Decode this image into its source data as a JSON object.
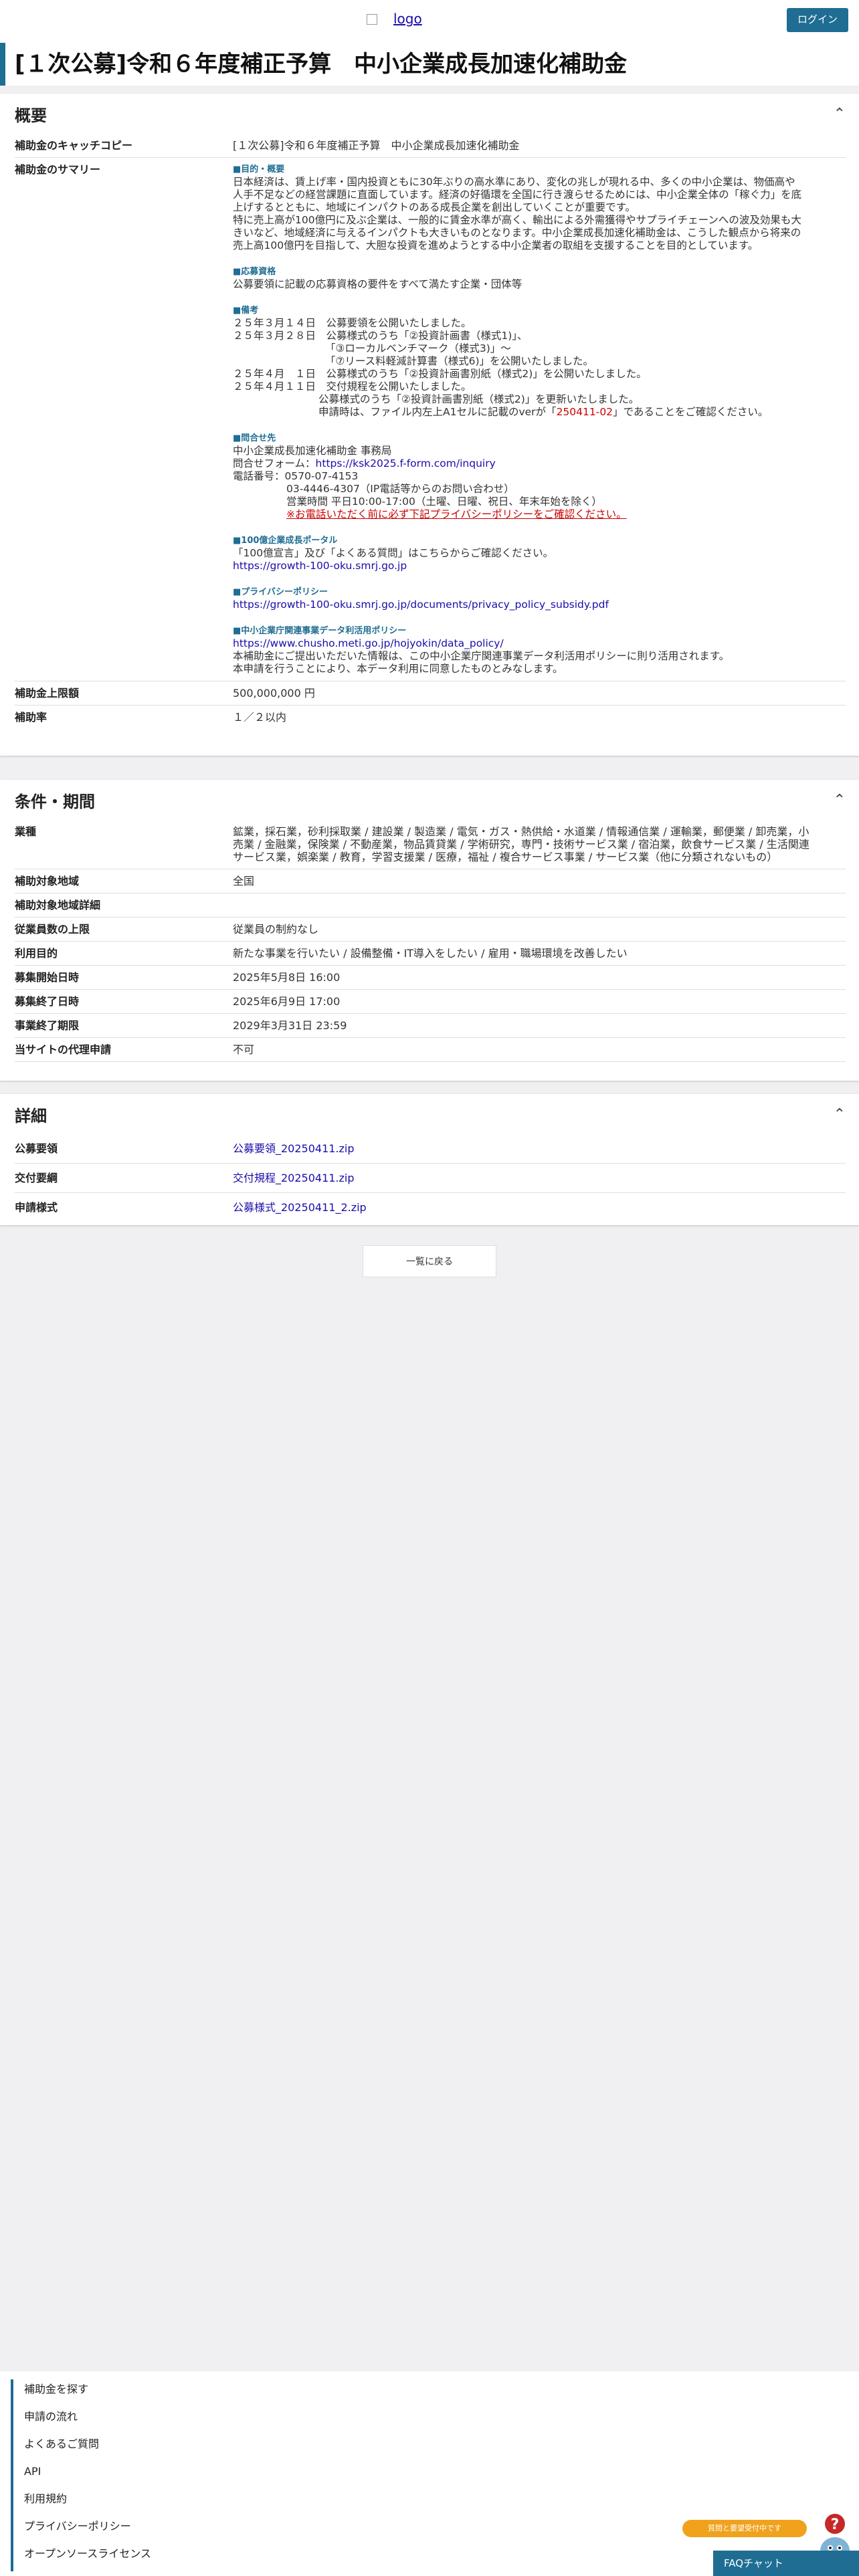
{
  "header": {
    "logo_alt": "logo",
    "login_label": "ログイン"
  },
  "page_title": "[１次公募]令和６年度補正予算　中小企業成長加速化補助金",
  "overview": {
    "heading": "概要",
    "catch_label": "補助金のキャッチコピー",
    "catch_value": "[１次公募]令和６年度補正予算　中小企業成長加速化補助金",
    "summary_label": "補助金のサマリー",
    "purpose_head": "■目的・概要",
    "purpose_l1": "日本経済は、賃上げ率・国内投資ともに30年ぶりの高水準にあり、変化の兆しが現れる中、多くの中小企業は、物価高や",
    "purpose_l2": "人手不足などの経営課題に直面しています。経済の好循環を全国に行き渡らせるためには、中小企業全体の「稼ぐ力」を底",
    "purpose_l3": "上げするとともに、地域にインパクトのある成長企業を創出していくことが重要です。",
    "purpose_l4": "特に売上高が100億円に及ぶ企業は、一般的に賃金水準が高く、輸出による外需獲得やサプライチェーンへの波及効果も大",
    "purpose_l5": "きいなど、地域経済に与えるインパクトも大きいものとなります。中小企業成長加速化補助金は、こうした観点から将来の",
    "purpose_l6": "売上高100億円を目指して、大胆な投資を進めようとする中小企業者の取組を支援することを目的としています。",
    "elig_head": "■応募資格",
    "elig_text": "公募要領に記載の応募資格の要件をすべて満たす企業・団体等",
    "notes_head": "■備考",
    "note1": "２５年３月１４日　公募要領を公開いたしました。",
    "note2a": "２５年３月２８日　公募様式のうち「②投資計画書（様式1)」、",
    "note2b": "「③ローカルベンチマーク（様式3)」～",
    "note2c": "「⑦リース料軽減計算書（様式6)」を公開いたしました。",
    "note3": "２５年４月　１日　公募様式のうち「②投資計画書別紙（様式2)」を公開いたしました。",
    "note4": "２５年４月１１日　交付規程を公開いたしました。",
    "note5a": "公募様式のうち「②投資計画書別紙（様式2)」を更新いたしました。",
    "note5b_pre": "申請時は、ファイル内左上A1セルに記載のverが「",
    "note5b_red": "250411-02",
    "note5b_post": "」であることをご確認ください。",
    "contact_head": "■問合せ先",
    "contact_name": "中小企業成長加速化補助金 事務局",
    "contact_form_label": "問合せフォーム：",
    "contact_form_url": "https://ksk2025.f-form.com/inquiry",
    "contact_tel": "電話番号：0570-07-4153",
    "contact_tel2": "03-4446-4307（IP電話等からのお問い合わせ）",
    "contact_hours": "営業時間 平日10:00-17:00（土曜、日曜、祝日、年末年始を除く）",
    "contact_warn": "※お電話いただく前に必ず下記プライバシーポリシーをご確認ください。",
    "portal_head": "■100億企業成長ポータル",
    "portal_text": "「100億宣言」及び「よくある質問」はこちらからご確認ください。",
    "portal_url": "https://growth-100-oku.smrj.go.jp",
    "privacy_head": "■プライバシーポリシー",
    "privacy_url": "https://growth-100-oku.smrj.go.jp/documents/privacy_policy_subsidy.pdf",
    "data_head": "■中小企業庁関連事業データ利活用ポリシー",
    "data_url": "https://www.chusho.meti.go.jp/hojyokin/data_policy/",
    "data_text1": "本補助金にご提出いただいた情報は、この中小企業庁関連事業データ利活用ポリシーに則り活用されます。",
    "data_text2": "本申請を行うことにより、本データ利用に同意したものとみなします。",
    "limit_label": "補助金上限額",
    "limit_value": "500,000,000 円",
    "rate_label": "補助率",
    "rate_value": "１／２以内"
  },
  "conditions": {
    "heading": "条件・期間",
    "industry_label": "業種",
    "industry_l1": "鉱業，採石業，砂利採取業 / 建設業 / 製造業 / 電気・ガス・熱供給・水道業 / 情報通信業 / 運輸業，郵便業 / 卸売業，小",
    "industry_l2": "売業 / 金融業，保険業 / 不動産業，物品賃貸業 / 学術研究，専門・技術サービス業 / 宿泊業，飲食サービス業 / 生活関連",
    "industry_l3": "サービス業，娯楽業 / 教育，学習支援業 / 医療，福祉 / 複合サービス事業 / サービス業（他に分類されないもの）",
    "region_label": "補助対象地域",
    "region_value": "全国",
    "region_detail_label": "補助対象地域詳細",
    "region_detail_value": "",
    "employees_label": "従業員数の上限",
    "employees_value": "従業員の制約なし",
    "purpose_label": "利用目的",
    "purpose_value": "新たな事業を行いたい / 設備整備・IT導入をしたい / 雇用・職場環境を改善したい",
    "start_label": "募集開始日時",
    "start_value": "2025年5月8日 16:00",
    "end_label": "募集終了日時",
    "end_value": "2025年6月9日 17:00",
    "project_end_label": "事業終了期限",
    "project_end_value": "2029年3月31日 23:59",
    "proxy_label": "当サイトの代理申請",
    "proxy_value": "不可"
  },
  "details": {
    "heading": "詳細",
    "guideline_label": "公募要領",
    "guideline_file": "公募要領_20250411.zip",
    "rules_label": "交付要綱",
    "rules_file": "交付規程_20250411.zip",
    "forms_label": "申請様式",
    "forms_file": "公募様式_20250411_2.zip"
  },
  "back_label": "一覧に戻る",
  "footer": {
    "items": [
      "補助金を探す",
      "申請の流れ",
      "よくあるご質問",
      "API",
      "利用規約",
      "プライバシーポリシー",
      "オープンソースライセンス"
    ]
  },
  "float_badge": "質問と要望受付中です",
  "chat_label": "FAQチャット",
  "chat_badge": "?"
}
